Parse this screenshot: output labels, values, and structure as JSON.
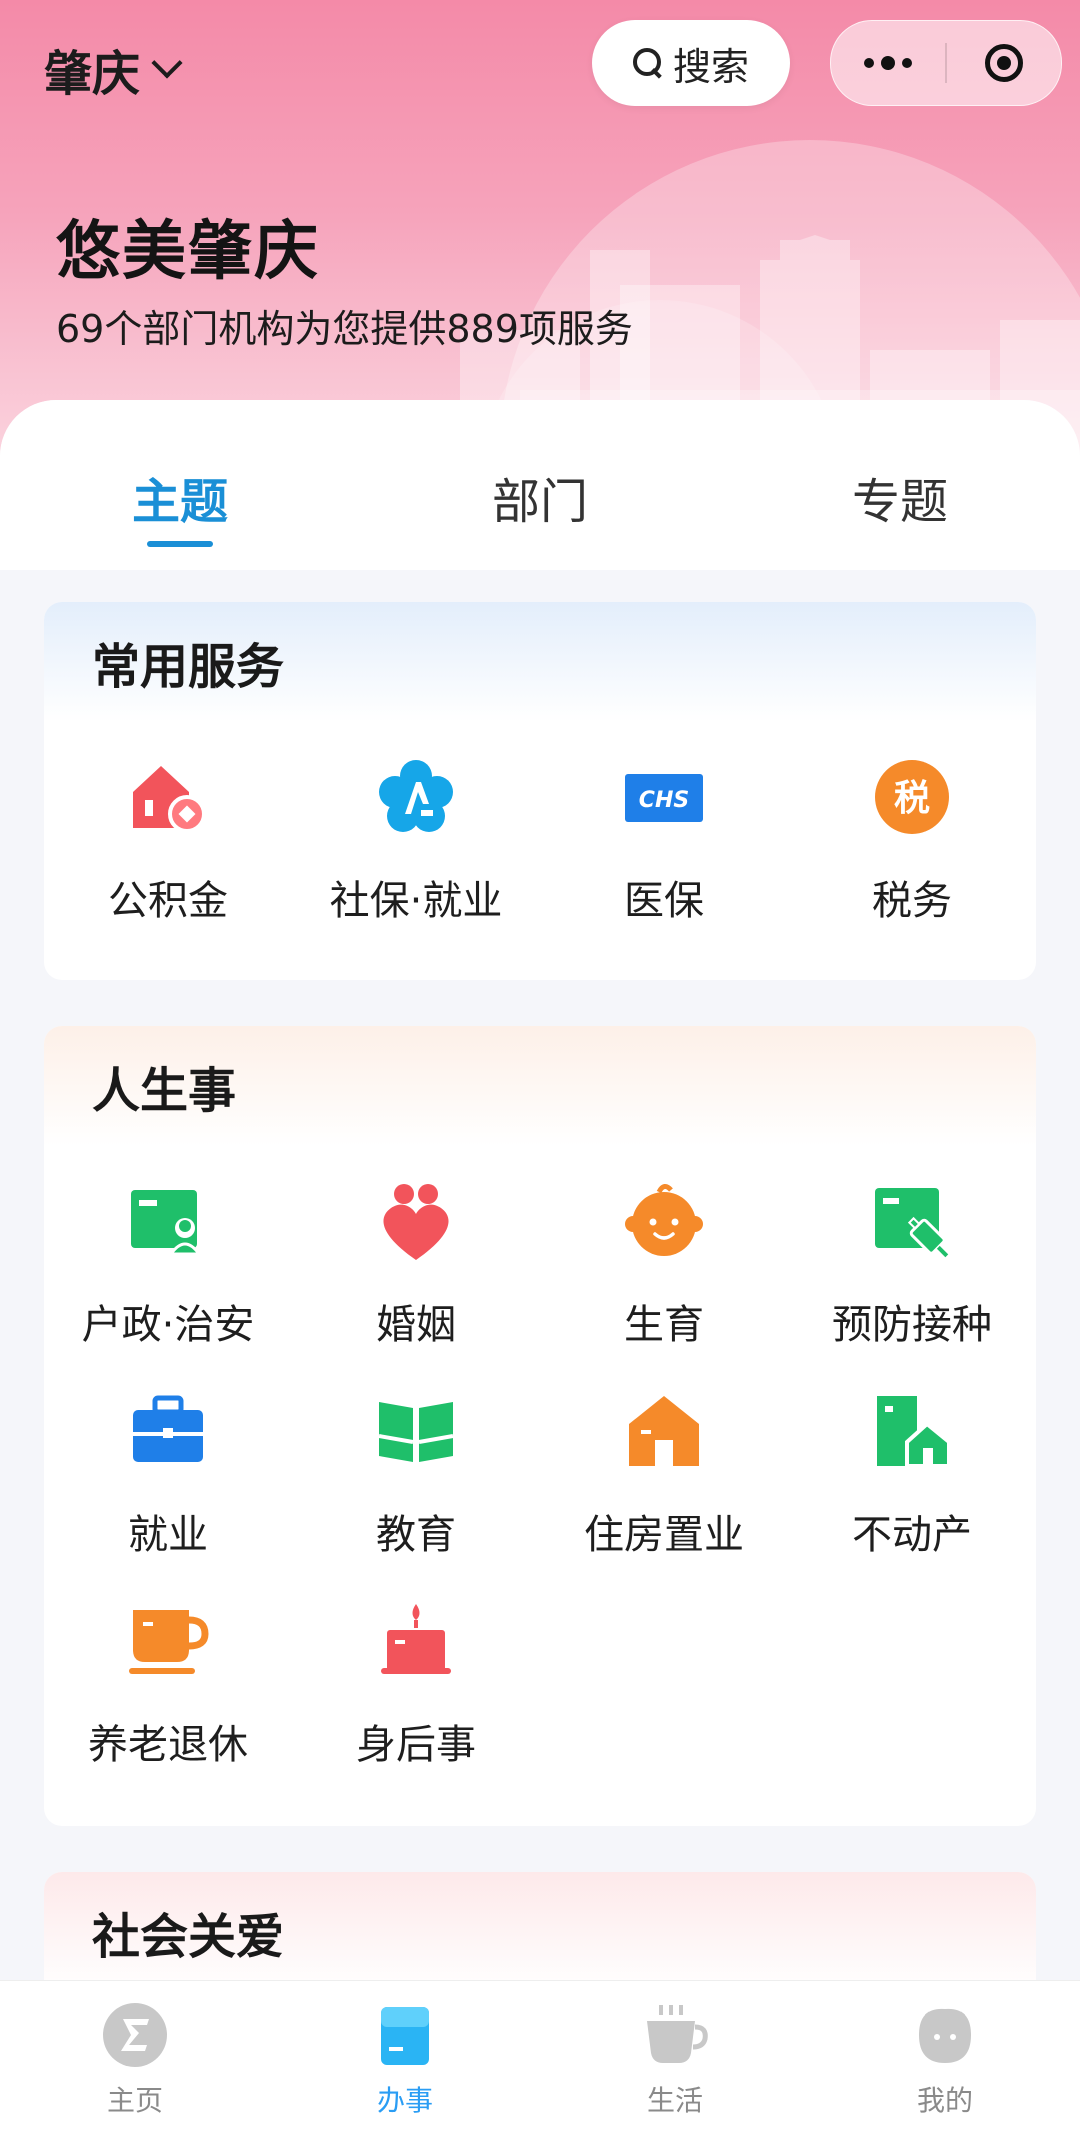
{
  "header": {
    "city": "肇庆",
    "search_label": "搜索",
    "title": "悠美肇庆",
    "subtitle": "69个部门机构为您提供889项服务"
  },
  "tabs": [
    {
      "label": "主题",
      "active": true
    },
    {
      "label": "部门",
      "active": false
    },
    {
      "label": "专题",
      "active": false
    }
  ],
  "common_services": {
    "title": "常用服务",
    "items": [
      {
        "label": "公积金",
        "icon": "house-coin-icon"
      },
      {
        "label": "社保·就业",
        "icon": "social-security-icon"
      },
      {
        "label": "医保",
        "icon": "chs-medical-insurance-icon"
      },
      {
        "label": "税务",
        "icon": "tax-icon"
      }
    ]
  },
  "life_events": {
    "title": "人生事",
    "items": [
      {
        "label": "户政·治安",
        "icon": "id-card-icon"
      },
      {
        "label": "婚姻",
        "icon": "heart-couple-icon"
      },
      {
        "label": "生育",
        "icon": "baby-face-icon"
      },
      {
        "label": "预防接种",
        "icon": "vaccine-icon"
      },
      {
        "label": "就业",
        "icon": "briefcase-icon"
      },
      {
        "label": "教育",
        "icon": "book-icon"
      },
      {
        "label": "住房置业",
        "icon": "house-icon"
      },
      {
        "label": "不动产",
        "icon": "real-estate-icon"
      },
      {
        "label": "养老退休",
        "icon": "teacup-icon"
      },
      {
        "label": "身后事",
        "icon": "candle-icon"
      }
    ]
  },
  "social_care": {
    "title": "社会关爱"
  },
  "bottom_nav": [
    {
      "label": "主页",
      "icon": "home-icon",
      "active": false
    },
    {
      "label": "办事",
      "icon": "services-icon",
      "active": true
    },
    {
      "label": "生活",
      "icon": "coffee-cup-icon",
      "active": false
    },
    {
      "label": "我的",
      "icon": "profile-icon",
      "active": false
    }
  ],
  "colors": {
    "accent": "#1a8fd6",
    "header_pink": "#f48aa8"
  }
}
